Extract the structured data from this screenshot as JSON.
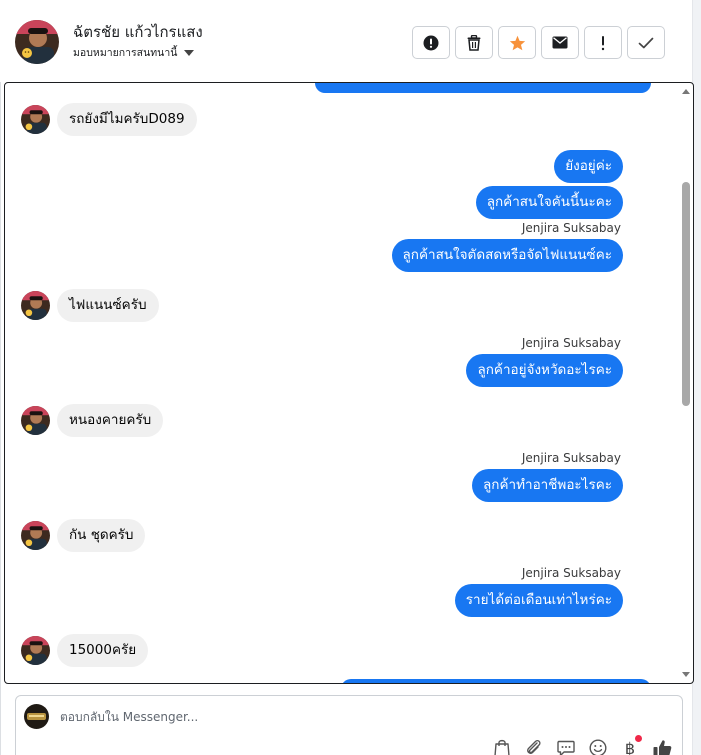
{
  "header": {
    "name": "ฉัตรชัย แก้วไกรแสง",
    "assign_label": "มอบหมายการสนทนานี้"
  },
  "actions": [
    {
      "name": "report-button",
      "icon": "exclamation-circle-icon"
    },
    {
      "name": "delete-button",
      "icon": "trash-icon"
    },
    {
      "name": "star-button",
      "icon": "star-icon"
    },
    {
      "name": "mark-unread-button",
      "icon": "envelope-icon"
    },
    {
      "name": "spam-button",
      "icon": "exclamation-icon"
    },
    {
      "name": "done-button",
      "icon": "check-icon"
    }
  ],
  "messages": {
    "m1": "รถยังมีไมครับD089",
    "m2": "ยังอยู่ค่ะ",
    "m3": "ลูกค้าสนใจคันนี้นะคะ",
    "m4_sender": "Jenjira Suksabay",
    "m4": "ลูกค้าสนใจตัดสดหรือจัดไฟแนนซ์คะ",
    "m5": "ไฟแนนซ์ครับ",
    "m6_sender": "Jenjira Suksabay",
    "m6": "ลูกค้าอยู่จังหวัดอะไรคะ",
    "m7": "หนองคายครับ",
    "m8_sender": "Jenjira Suksabay",
    "m8": "ลูกค้าทำอาชีพอะไรคะ",
    "m9": "กัน ชุดครับ",
    "m10_sender": "Jenjira Suksabay",
    "m10": "รายได้ต่อเดือนเท่าไหร่คะ",
    "m11": "15000ครัย"
  },
  "composer": {
    "placeholder": "ตอบกลับใน Messenger..."
  },
  "colors": {
    "accent": "#1877f2",
    "incoming_bubble": "#f0f0f0",
    "star": "#f7923b",
    "notification": "#f02849"
  }
}
